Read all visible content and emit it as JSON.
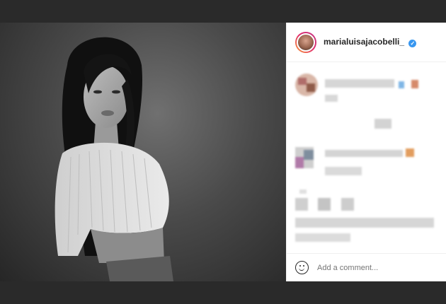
{
  "post": {
    "username": "marialuisajacobelli_",
    "verified_mark": "✓",
    "comment_placeholder": "Add a comment..."
  },
  "icons": {
    "verified": "verified-badge-icon",
    "emoji": "emoji-smiley-icon"
  },
  "colors": {
    "accent": "#3897f0",
    "panel_bg": "#ffffff",
    "frame_bg": "#2a2a2a"
  }
}
